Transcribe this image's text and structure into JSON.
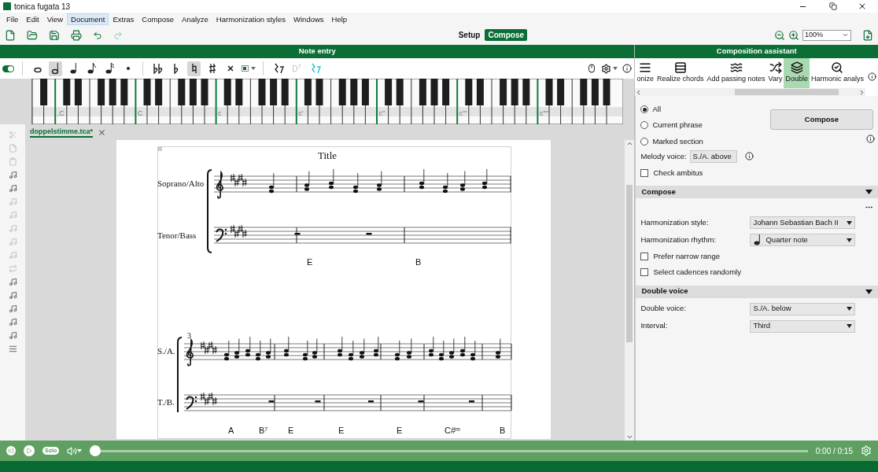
{
  "window": {
    "title": "tonica fugata 13"
  },
  "menu": [
    {
      "label": "File",
      "selected": false
    },
    {
      "label": "Edit",
      "selected": false
    },
    {
      "label": "View",
      "selected": false
    },
    {
      "label": "Document",
      "selected": true
    },
    {
      "label": "Extras",
      "selected": false
    },
    {
      "label": "Compose",
      "selected": false
    },
    {
      "label": "Analyze",
      "selected": false
    },
    {
      "label": "Harmonization styles",
      "selected": false
    },
    {
      "label": "Windows",
      "selected": false
    },
    {
      "label": "Help",
      "selected": false
    }
  ],
  "mode_switch": [
    {
      "label": "Setup",
      "selected": false
    },
    {
      "label": "Compose",
      "selected": true
    }
  ],
  "zoom": {
    "value": "100%"
  },
  "note_entry": {
    "title": "Note entry",
    "tools": [
      {
        "kind": "toggle",
        "on": true
      },
      {
        "kind": "separator"
      },
      {
        "kind": "whole",
        "selected": false
      },
      {
        "kind": "half",
        "selected": true
      },
      {
        "kind": "quarter",
        "selected": false
      },
      {
        "kind": "eighth",
        "selected": false
      },
      {
        "kind": "sixteenth",
        "selected": false
      },
      {
        "kind": "dot",
        "selected": false
      },
      {
        "kind": "separator"
      },
      {
        "kind": "doubleflat",
        "selected": false
      },
      {
        "kind": "flat",
        "selected": false
      },
      {
        "kind": "natural",
        "selected": true
      },
      {
        "kind": "sharp",
        "selected": false
      },
      {
        "kind": "doublesharp",
        "selected": false
      },
      {
        "kind": "boxmenu",
        "selected": false
      },
      {
        "kind": "separator"
      },
      {
        "kind": "rest",
        "selected": false
      },
      {
        "kind": "text",
        "label": "D$^{7}$",
        "disabled": true
      },
      {
        "kind": "cyanrest",
        "selected": false
      }
    ]
  },
  "keyboard": {
    "octave_labels": [
      ",C",
      "C",
      "c",
      "c'",
      "c''",
      "c'''",
      "c''''"
    ]
  },
  "document": {
    "tab": {
      "label": "doppelstimme.tca*",
      "selected": true
    },
    "score": {
      "title": "Title",
      "systems": [
        {
          "staves": [
            "Soprano/Alto",
            "Tenor/Bass"
          ],
          "chords": [
            "E",
            "B"
          ]
        },
        {
          "measure_number": "3",
          "staves": [
            "S./A.",
            "T./B."
          ],
          "chords": [
            "A",
            "B$^{7}$",
            "E",
            "E",
            "E",
            "C#$^{m}$",
            "B"
          ]
        }
      ]
    }
  },
  "assistant": {
    "title": "Composition assistant",
    "tabs": [
      {
        "label": "onize",
        "selected": false
      },
      {
        "label": "Realize chords",
        "selected": false
      },
      {
        "label": "Add passing notes",
        "selected": false
      },
      {
        "label": "Vary",
        "selected": false
      },
      {
        "label": "Double",
        "selected": true
      },
      {
        "label": "Harmonic analys",
        "selected": false
      }
    ],
    "scope": [
      {
        "label": "All",
        "selected": true
      },
      {
        "label": "Current phrase",
        "selected": false
      },
      {
        "label": "Marked section",
        "selected": false
      }
    ],
    "compose_button": "Compose",
    "melody_voice": {
      "label": "Melody voice:",
      "value": "S./A. above"
    },
    "check_ambitus": {
      "label": "Check ambitus",
      "checked": false
    },
    "sections": [
      {
        "title": "Compose",
        "expanded": true,
        "fields": [
          {
            "kind": "select",
            "label": "Harmonization style:",
            "value": "Johann Sebastian Bach II"
          },
          {
            "kind": "select",
            "label": "Harmonization rhythm:",
            "value": "Quarter note",
            "note_icon": true
          },
          {
            "kind": "checkbox",
            "label": "Prefer narrow range",
            "checked": false
          },
          {
            "kind": "checkbox",
            "label": "Select cadences randomly",
            "checked": false
          }
        ]
      },
      {
        "title": "Double voice",
        "expanded": true,
        "fields": [
          {
            "kind": "select",
            "label": "Double voice:",
            "value": "S./A. below"
          },
          {
            "kind": "select",
            "label": "Interval:",
            "value": "Third"
          }
        ]
      }
    ]
  },
  "player": {
    "solo": "Solo",
    "level": 0,
    "time": "0:00 / 0:15"
  }
}
